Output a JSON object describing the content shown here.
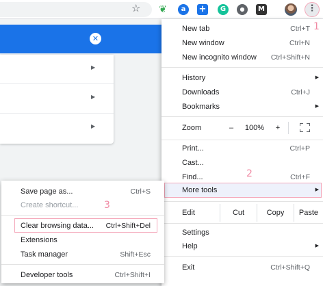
{
  "toolbar": {
    "extensions": [
      {
        "name": "green-leaf-extension",
        "glyph": "❦",
        "color": "#34a853"
      },
      {
        "name": "a-extension",
        "glyph": "a",
        "color": "#1a73e8"
      },
      {
        "name": "plus-extension",
        "glyph": "+",
        "color": "#1a73e8"
      },
      {
        "name": "grammarly-extension",
        "glyph": "G",
        "color": "#15c39a"
      },
      {
        "name": "circle-extension",
        "glyph": "●",
        "color": "#5f6368"
      },
      {
        "name": "mail-extension",
        "glyph": "M",
        "color": "#333333"
      }
    ],
    "menu_glyph": "⋮",
    "star_glyph": "☆"
  },
  "page": {
    "header_color": "#1a73e8",
    "close_glyph": "✕",
    "row_arrow": "▶"
  },
  "menu": {
    "new_tab": {
      "label": "New tab",
      "shortcut": "Ctrl+T"
    },
    "new_window": {
      "label": "New window",
      "shortcut": "Ctrl+N"
    },
    "new_incognito": {
      "label": "New incognito window",
      "shortcut": "Ctrl+Shift+N"
    },
    "history": {
      "label": "History"
    },
    "downloads": {
      "label": "Downloads",
      "shortcut": "Ctrl+J"
    },
    "bookmarks": {
      "label": "Bookmarks"
    },
    "zoom": {
      "label": "Zoom",
      "minus": "–",
      "value": "100%",
      "plus": "+"
    },
    "print": {
      "label": "Print...",
      "shortcut": "Ctrl+P"
    },
    "cast": {
      "label": "Cast..."
    },
    "find": {
      "label": "Find...",
      "shortcut": "Ctrl+F"
    },
    "more_tools": {
      "label": "More tools"
    },
    "edit": {
      "label": "Edit",
      "cut": "Cut",
      "copy": "Copy",
      "paste": "Paste"
    },
    "settings": {
      "label": "Settings"
    },
    "help": {
      "label": "Help"
    },
    "exit": {
      "label": "Exit",
      "shortcut": "Ctrl+Shift+Q"
    },
    "arrow": "▶"
  },
  "submenu": {
    "save_page": {
      "label": "Save page as...",
      "shortcut": "Ctrl+S"
    },
    "create_shortcut": {
      "label": "Create shortcut..."
    },
    "clear_browsing": {
      "label": "Clear browsing data...",
      "shortcut": "Ctrl+Shift+Del"
    },
    "extensions": {
      "label": "Extensions"
    },
    "task_manager": {
      "label": "Task manager",
      "shortcut": "Shift+Esc"
    },
    "developer_tools": {
      "label": "Developer tools",
      "shortcut": "Ctrl+Shift+I"
    }
  },
  "annotations": {
    "step1": "1",
    "step2": "2",
    "step3": "3",
    "color": "#f08aa4"
  }
}
